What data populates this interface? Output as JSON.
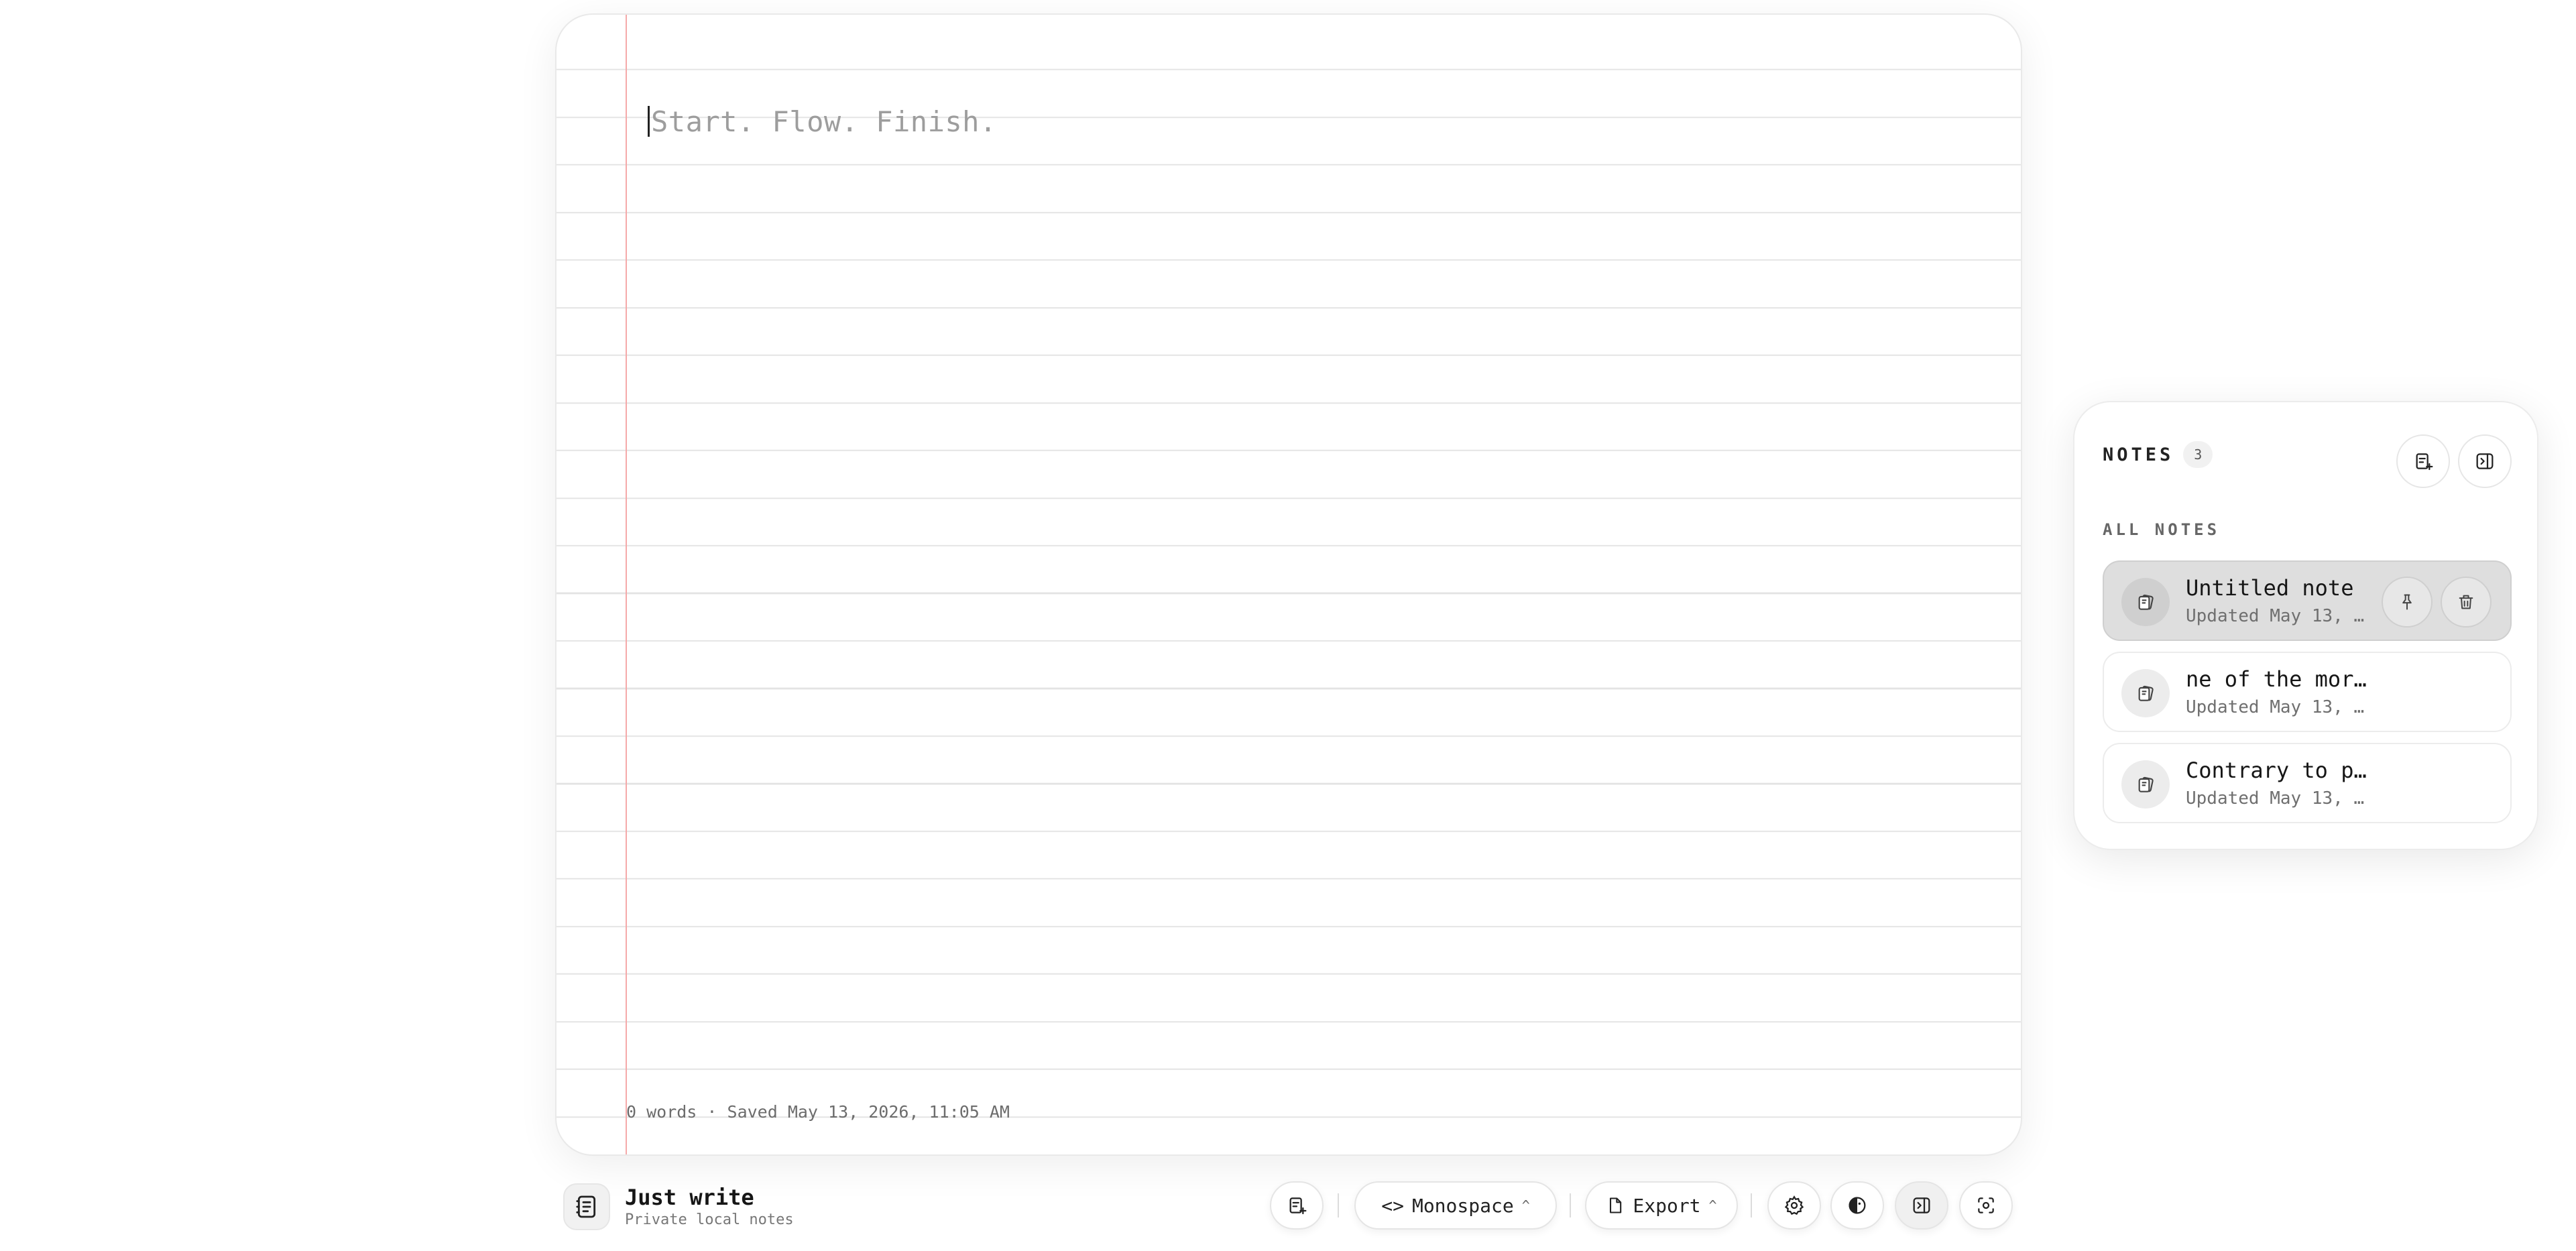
{
  "editor": {
    "placeholder": "Start. Flow. Finish.",
    "status": "0 words · Saved May 13, 2026, 11:05 AM"
  },
  "app": {
    "title": "Just write",
    "subtitle": "Private local notes"
  },
  "toolbar": {
    "font_label": "Monospace",
    "export_label": "Export",
    "icons": [
      "new-note-icon",
      "code-icon",
      "file-icon",
      "settings-icon",
      "theme-icon",
      "sidebar-icon",
      "focus-icon"
    ]
  },
  "notes_panel": {
    "title": "NOTES",
    "count": "3",
    "section": "ALL NOTES",
    "notes": [
      {
        "title": "Untitled note",
        "meta": "Updated May 13, …",
        "selected": true
      },
      {
        "title": "ne of the mor…",
        "meta": "Updated May 13, …",
        "selected": false
      },
      {
        "title": "Contrary to p…",
        "meta": "Updated May 13, …",
        "selected": false
      }
    ]
  },
  "colors": {
    "margin_line": "#f5a9a9",
    "rule_line": "#e3e3e3",
    "selected_note": "#dedede"
  }
}
